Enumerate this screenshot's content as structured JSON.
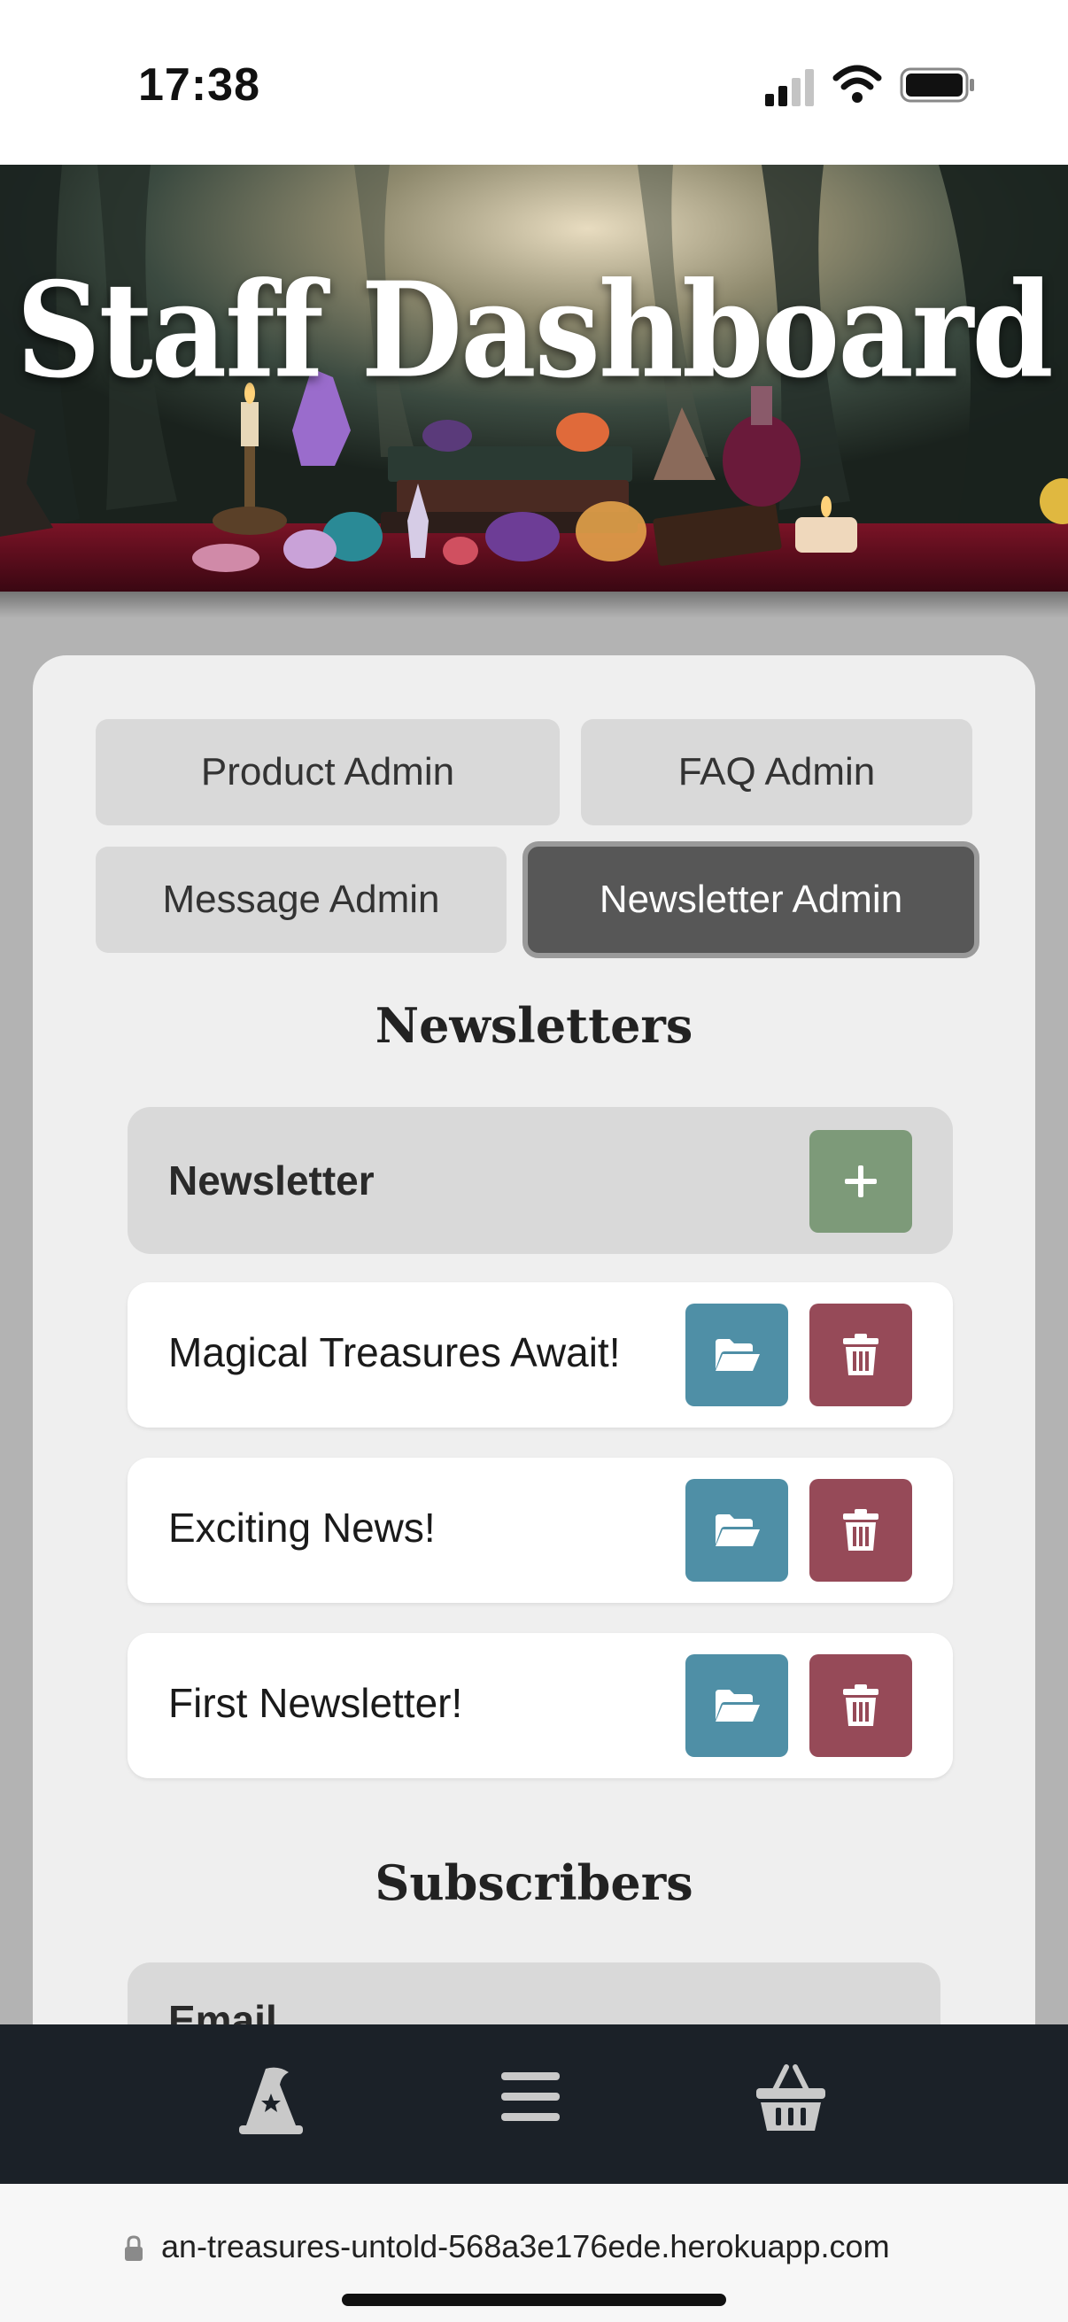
{
  "status_bar": {
    "time": "17:38"
  },
  "hero": {
    "title": "Staff Dashboard"
  },
  "tabs": {
    "product": "Product Admin",
    "faq": "FAQ Admin",
    "message": "Message Admin",
    "newsletter": "Newsletter Admin",
    "active": "Newsletter Admin"
  },
  "newsletters": {
    "title": "Newsletters",
    "header_label": "Newsletter",
    "add_icon": "plus-icon",
    "rows": [
      {
        "title": "Magical Treasures Await!"
      },
      {
        "title": "Exciting News!"
      },
      {
        "title": "First Newsletter!"
      }
    ],
    "row_actions": [
      "folder-open-icon",
      "trash-icon"
    ]
  },
  "subscribers": {
    "title": "Subscribers",
    "header_label": "Email"
  },
  "bottom_nav": {
    "items": [
      "wizard-hat-icon",
      "menu-icon",
      "basket-icon"
    ]
  },
  "url_bar": {
    "url": "an-treasures-untold-568a3e176ede.herokuapp.com"
  },
  "colors": {
    "add_button": "#7d9a79",
    "open_button": "#4f8fa6",
    "delete_button": "#964a58",
    "active_tab": "#575757",
    "nav_background": "#1b2128"
  }
}
